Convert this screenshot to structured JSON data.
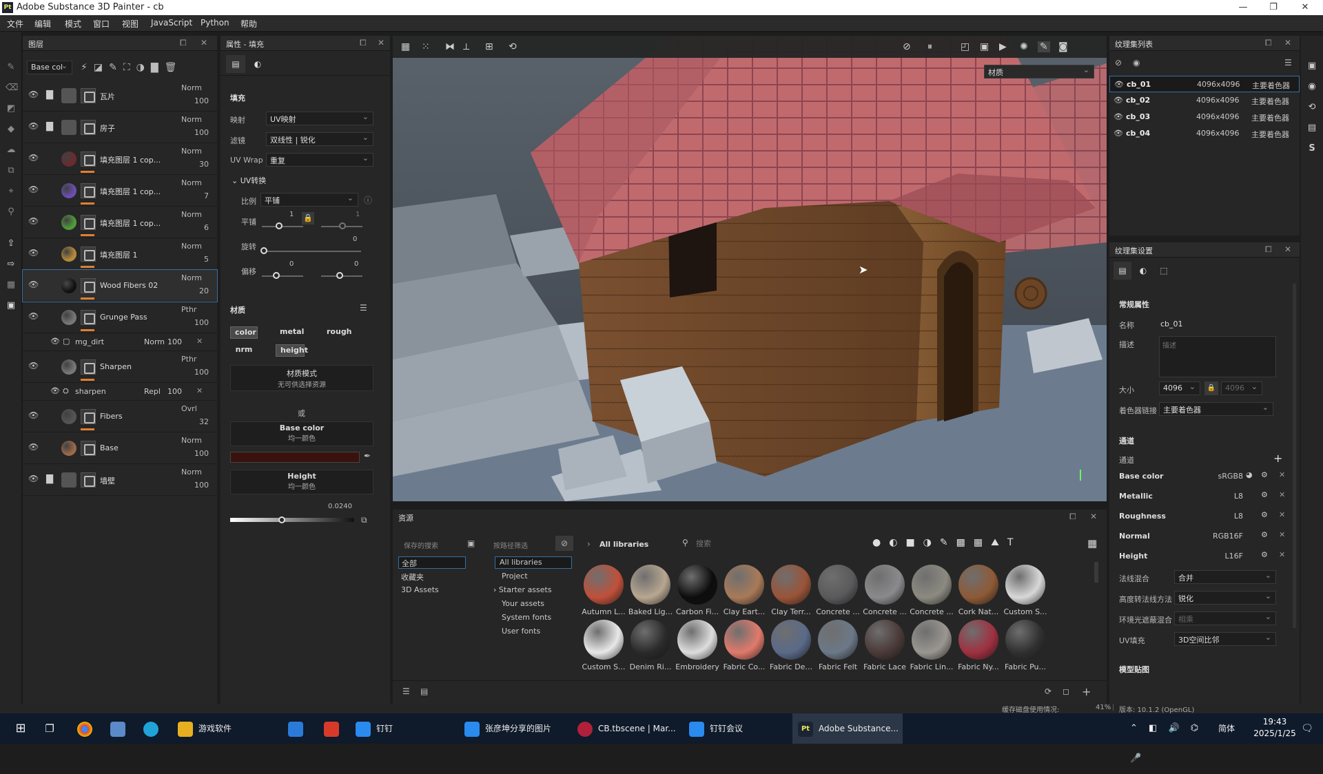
{
  "app": {
    "title": "Adobe Substance 3D Painter - cb",
    "logo": "Pt"
  },
  "menu": [
    "文件",
    "编辑",
    "模式",
    "窗口",
    "视图",
    "JavaScript",
    "Python",
    "帮助"
  ],
  "layers": {
    "title": "图层",
    "channel": "Base col",
    "rows": [
      {
        "name": "瓦片",
        "blend": "Norm",
        "opacity": "100",
        "color": "#555",
        "folder": true,
        "bar": false
      },
      {
        "name": "房子",
        "blend": "Norm",
        "opacity": "100",
        "color": "#555",
        "folder": true,
        "bar": false
      },
      {
        "name": "填充图层 1 cop...",
        "blend": "Norm",
        "opacity": "30",
        "color": "#6b2a30",
        "folder": false,
        "bar": true
      },
      {
        "name": "填充图层 1 cop...",
        "blend": "Norm",
        "opacity": "7",
        "color": "#6a4fb0",
        "folder": false,
        "bar": true
      },
      {
        "name": "填充图层 1 cop...",
        "blend": "Norm",
        "opacity": "6",
        "color": "#4e9b3a",
        "folder": false,
        "bar": true
      },
      {
        "name": "填充图层 1",
        "blend": "Norm",
        "opacity": "5",
        "color": "#b58a3a",
        "folder": false,
        "bar": true
      },
      {
        "name": "Wood Fibers 02",
        "blend": "Norm",
        "opacity": "20",
        "color": "#111",
        "folder": false,
        "bar": true
      },
      {
        "name": "Grunge Pass",
        "blend": "Pthr",
        "opacity": "100",
        "color": "#777",
        "folder": false,
        "bar": true
      }
    ],
    "sub1": {
      "name": "mg_dirt",
      "blend": "Norm",
      "opacity": "100"
    },
    "rows2": [
      {
        "name": "Sharpen",
        "blend": "Pthr",
        "opacity": "100",
        "color": "#777"
      },
      {
        "name": "Fibers",
        "blend": "Ovrl",
        "opacity": "32",
        "color": "#555"
      },
      {
        "name": "Base",
        "blend": "Norm",
        "opacity": "100",
        "color": "#9b6a48"
      },
      {
        "name": "墙壁",
        "blend": "Norm",
        "opacity": "100",
        "color": "#555"
      }
    ],
    "sub2": {
      "name": "sharpen",
      "blend": "Repl",
      "opacity": "100"
    }
  },
  "props": {
    "title": "属性 - 填充",
    "fill": "填充",
    "mapping_label": "映射",
    "mapping": "UV映射",
    "filter_label": "滤镜",
    "filter": "双线性 | 锐化",
    "uvwrap_label": "UV Wrap",
    "uvwrap": "重复",
    "uvtransform": "UV转换",
    "scale_label": "比例",
    "scale": "平铺",
    "tile_label": "平铺",
    "tile_val": "1",
    "tile_val2": "1",
    "rot_label": "旋转",
    "rot_val": "0",
    "offset_label": "偏移",
    "off1": "0",
    "off2": "0",
    "material": "材质",
    "chips": [
      "color",
      "metal",
      "rough",
      "nrm",
      "height"
    ],
    "mode_title": "材质模式",
    "mode_sub": "无可供选择资源",
    "or": "或",
    "basecolor_title": "Base color",
    "basecolor_sub": "均一颜色",
    "height_title": "Height",
    "height_sub": "均一颜色",
    "height_val": "0.0240",
    "basecolor_hex": "#3a120d"
  },
  "viewport": {
    "mode_select": "材质"
  },
  "assets": {
    "title": "资源",
    "saved_search": "保存的搜索",
    "path_filter": "按路径筛选",
    "crumb": "All libraries",
    "search_placeholder": "搜索",
    "left": [
      "全部",
      "收藏夹",
      "3D Assets"
    ],
    "libs": [
      "All libraries",
      "Project",
      "Starter assets",
      "Your assets",
      "System fonts",
      "User fonts"
    ],
    "row1": [
      {
        "label": "Autumn L...",
        "color": "#c0503a"
      },
      {
        "label": "Baked Lig...",
        "color": "#b8a690"
      },
      {
        "label": "Carbon Fi...",
        "color": "#0d0d0d"
      },
      {
        "label": "Clay Eart...",
        "color": "#a87a58"
      },
      {
        "label": "Clay Terr...",
        "color": "#9a5438"
      },
      {
        "label": "Concrete ...",
        "color": "#5a5a5c"
      },
      {
        "label": "Concrete ...",
        "color": "#8a8a8c"
      },
      {
        "label": "Concrete ...",
        "color": "#8c8a80"
      },
      {
        "label": "Cork Nat...",
        "color": "#8e5a36"
      },
      {
        "label": "Custom S...",
        "color": "#d8d8d8"
      }
    ],
    "row2": [
      {
        "label": "Custom S...",
        "color": "#e8e8e8"
      },
      {
        "label": "Denim Ri...",
        "color": "#2a2a2a"
      },
      {
        "label": "Embroidery",
        "color": "#ddd"
      },
      {
        "label": "Fabric Co...",
        "color": "#e07a6c"
      },
      {
        "label": "Fabric De...",
        "color": "#5a6a88"
      },
      {
        "label": "Fabric Felt",
        "color": "#6c7888"
      },
      {
        "label": "Fabric Lace",
        "color": "#4a3a38"
      },
      {
        "label": "Fabric Lin...",
        "color": "#9a9690"
      },
      {
        "label": "Fabric Ny...",
        "color": "#a03040"
      },
      {
        "label": "Fabric Pu...",
        "color": "#303030"
      }
    ]
  },
  "texlist": {
    "title": "纹理集列表",
    "rows": [
      {
        "name": "cb_01",
        "size": "4096x4096",
        "shader": "主要着色器"
      },
      {
        "name": "cb_02",
        "size": "4096x4096",
        "shader": "主要着色器"
      },
      {
        "name": "cb_03",
        "size": "4096x4096",
        "shader": "主要着色器"
      },
      {
        "name": "cb_04",
        "size": "4096x4096",
        "shader": "主要着色器"
      }
    ]
  },
  "texset": {
    "title": "纹理集设置",
    "general": "常规属性",
    "name_label": "名称",
    "name": "cb_01",
    "desc_label": "描述",
    "desc_placeholder": "描述",
    "size_label": "大小",
    "size": "4096",
    "size2": "4096",
    "shader_label": "着色器链接",
    "shader": "主要着色器",
    "channels_title": "通道",
    "channels_label": "通道",
    "channels": [
      {
        "name": "Base color",
        "fmt": "sRGB8"
      },
      {
        "name": "Metallic",
        "fmt": "L8"
      },
      {
        "name": "Roughness",
        "fmt": "L8"
      },
      {
        "name": "Normal",
        "fmt": "RGB16F"
      },
      {
        "name": "Height",
        "fmt": "L16F"
      }
    ],
    "normal_mix_label": "法线混合",
    "normal_mix": "合并",
    "h2n_label": "高度转法线方法",
    "h2n": "锐化",
    "ao_label": "环境光遮蔽混合",
    "ao": "相乘",
    "uvpad_label": "UV填充",
    "uvpad": "3D空间比邻",
    "modelmaps": "模型贴图"
  },
  "status": {
    "cache": "缓存磁盘使用情况:",
    "percent": "41%",
    "version": "版本: 10.1.2 (OpenGL)"
  },
  "taskbar": {
    "items": [
      "游戏软件",
      "钉钉",
      "张彦坤分享的图片",
      "CB.tbscene | Mar...",
      "钉钉会议",
      "Adobe Substance..."
    ],
    "lang": "简体",
    "time": "19:43",
    "date": "2025/1/25"
  }
}
